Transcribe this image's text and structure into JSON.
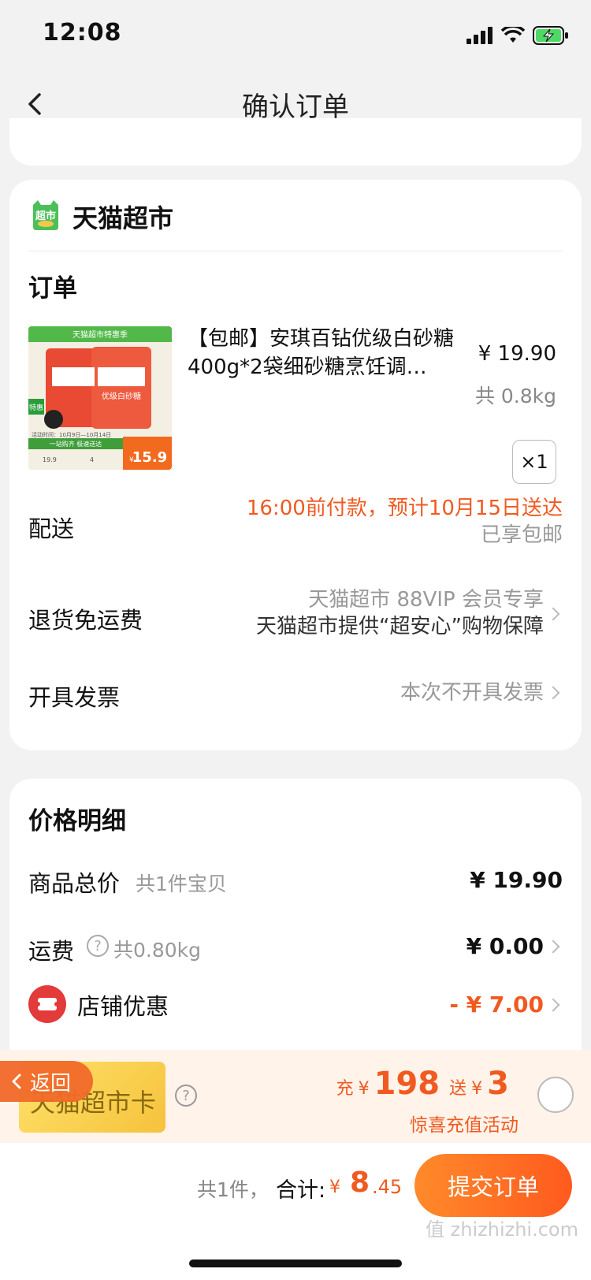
{
  "status": {
    "time": "12:08"
  },
  "nav": {
    "title": "确认订单"
  },
  "shop": {
    "name": "天猫超市",
    "logo_text": "超市"
  },
  "order": {
    "label": "订单",
    "product": {
      "title": "【包邮】安琪百钻优级白砂糖400g*2袋细砂糖烹饪调…",
      "price": "¥ 19.90",
      "weight": "共 0.8kg",
      "quantity": "×1",
      "image": {
        "banner": "天猫超市特惠季",
        "badge": "特惠",
        "package_label": "优级白砂糖",
        "promo_date": "活动时间：10月9日—10月14日",
        "promo_line": "一站购齐 极速送达",
        "prices": [
          "19.9",
          "4"
        ],
        "final_price_yen": "¥",
        "final_price": "15.9"
      }
    },
    "delivery": {
      "label": "配送",
      "line1": "16:00前付款，预计10月15日送达",
      "line2": "已享包邮"
    },
    "returns": {
      "label": "退货免运费",
      "line1": "天猫超市 88VIP 会员专享",
      "line2": "天猫超市提供“超安心”购物保障"
    },
    "invoice": {
      "label": "开具发票",
      "value": "本次不开具发票"
    }
  },
  "price_detail": {
    "title": "价格明细",
    "goods_total_label": "商品总价",
    "goods_total_note": "共1件宝贝",
    "goods_total": "¥ 19.90",
    "shipping_label": "运费",
    "shipping_note": "共0.80kg",
    "shipping": "¥ 0.00",
    "discount_label": "店铺优惠",
    "discount": "- ¥ 7.00"
  },
  "promo": {
    "card_text": "天猫超市卡",
    "back_label": "返回",
    "recharge_prefix": "充",
    "recharge_amount": "198",
    "gift_prefix": "送",
    "gift_amount": "3",
    "yen": "¥",
    "subtitle": "惊喜充值活动"
  },
  "footer": {
    "count": "共1件，",
    "total_label": "合计:",
    "yen": "¥",
    "total_int": "8",
    "total_dec": ".45",
    "submit": "提交订单",
    "watermark": "值 zhizhizhi.com"
  },
  "colors": {
    "accent": "#f05a20",
    "price_red": "#e33a3a",
    "tmall_green": "#4cbf5a"
  }
}
